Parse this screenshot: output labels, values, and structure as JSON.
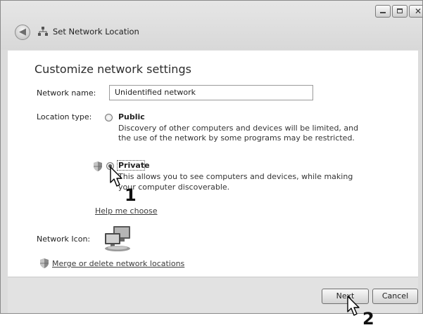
{
  "window": {
    "title": "Set Network Location",
    "buttons": [
      "minimize",
      "maximize",
      "close"
    ]
  },
  "content": {
    "heading": "Customize network settings",
    "network_name_label": "Network name:",
    "network_name_value": "Unidentified network",
    "location_type_label": "Location type:",
    "public_option": {
      "label": "Public",
      "description_line1": "Discovery of other computers and devices will be limited, and",
      "description_line2": "the use of the network by some programs may be restricted."
    },
    "private_option": {
      "label": "Private",
      "description_line1": "This allows you to see computers and devices, while making",
      "description_line2": "your computer discoverable.",
      "selected": true
    },
    "help_link": "Help me choose",
    "network_icon_label": "Network Icon:",
    "merge_link": "Merge or delete network locations"
  },
  "footer": {
    "next_button": "Next",
    "cancel_button": "Cancel"
  },
  "annotations": {
    "step1": "1",
    "step2": "2"
  }
}
